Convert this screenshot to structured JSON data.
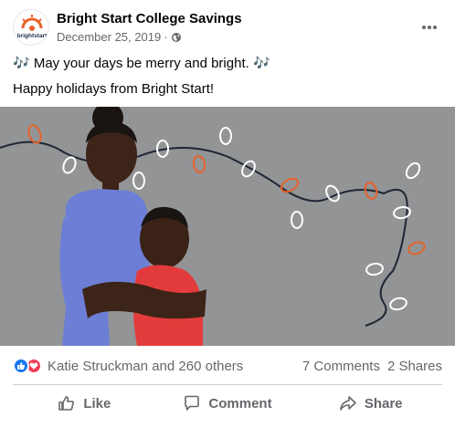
{
  "post": {
    "page_name": "Bright Start College Savings",
    "date": "December 25, 2019",
    "separator": "·",
    "avatar_logo_text": "brightstart",
    "message_lines": [
      "🎶 May your days be merry and bright. 🎶",
      "Happy holidays from Bright Start!"
    ]
  },
  "stats": {
    "reactors": "Katie Struckman and 260 others",
    "comments": "7 Comments",
    "shares": "2 Shares"
  },
  "actions": {
    "like": "Like",
    "comment": "Comment",
    "share": "Share"
  },
  "icons": {
    "globe": "globe-icon",
    "more": "more-options-icon",
    "like_reaction": "like-reaction-icon",
    "love_reaction": "love-reaction-icon",
    "like_action": "thumbs-up-icon",
    "comment_action": "speech-bubble-icon",
    "share_action": "share-arrow-icon"
  },
  "colors": {
    "brand_orange": "#e8622a",
    "like_blue": "#1877f2",
    "love_red": "#f33e58",
    "secondary_text": "#65676b",
    "photo_background": "#8f9192",
    "girl_shirt": "#6d7ed6",
    "boy_shirt": "#e33b3b"
  }
}
